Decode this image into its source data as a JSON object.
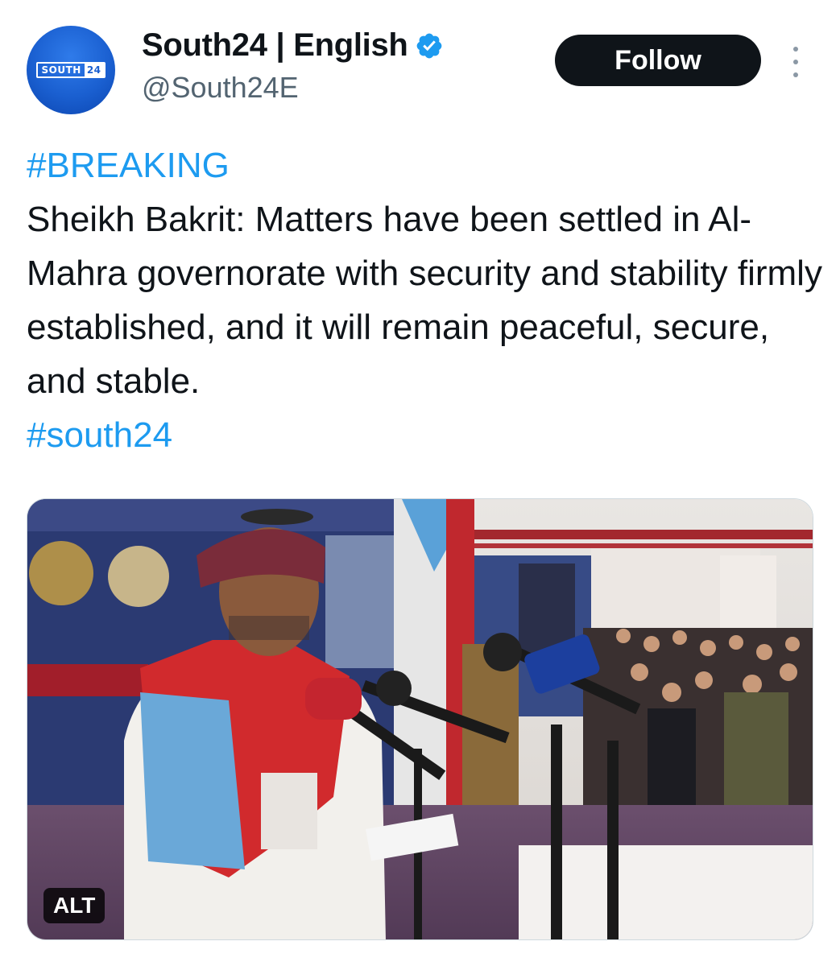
{
  "author": {
    "display_name": "South24 | English",
    "handle": "@South24E",
    "avatar_logo_left": "SOUTH",
    "avatar_logo_right": "24",
    "verified_icon": "verified-badge-icon",
    "verified_color": "#1d9bf0"
  },
  "actions": {
    "follow_label": "Follow",
    "more_icon": "more-vertical-icon"
  },
  "tweet": {
    "hashtag_top": "#BREAKING",
    "body": "Sheikh Bakrit: Matters have been settled in Al-Mahra governorate with security and stability firmly established, and it will remain peaceful, secure, and stable.",
    "hashtag_bottom": "#south24",
    "hashtag_color": "#1d9bf0"
  },
  "media": {
    "alt_label": "ALT"
  }
}
